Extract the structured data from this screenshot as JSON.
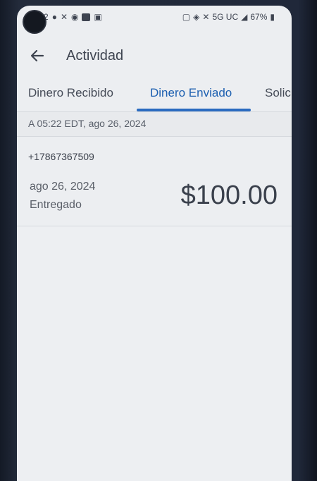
{
  "status_bar": {
    "time_fragment": "2",
    "left_icons": [
      "chat-icon",
      "x-icon",
      "circle-icon",
      "box-s-icon",
      "image-icon"
    ],
    "network": "5G UC",
    "battery": "67%"
  },
  "header": {
    "title": "Actividad"
  },
  "tabs": [
    {
      "label": "Dinero Recibido",
      "active": false
    },
    {
      "label": "Dinero Enviado",
      "active": true
    },
    {
      "label": "Solic",
      "active": false
    }
  ],
  "activity": {
    "group_header": "A 05:22 EDT, ago 26, 2024",
    "transactions": [
      {
        "recipient": "+17867367509",
        "date": "ago 26, 2024",
        "status": "Entregado",
        "amount": "$100.00"
      }
    ]
  },
  "colors": {
    "accent": "#2a6bc0",
    "background": "#eceef1",
    "text": "#3e4450"
  }
}
